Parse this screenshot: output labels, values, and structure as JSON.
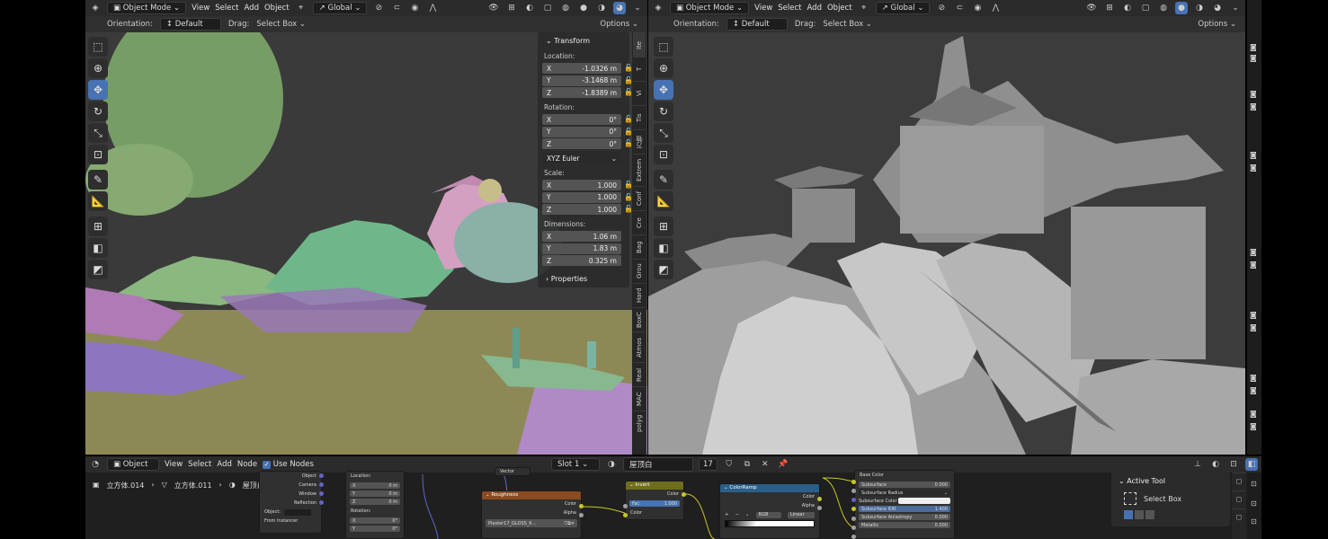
{
  "left_viewport": {
    "header": {
      "mode": "Object Mode",
      "menus": [
        "View",
        "Select",
        "Add",
        "Object"
      ],
      "transform_orientation": "Global",
      "options": "Options"
    },
    "subheader": {
      "orientation_label": "Orientation:",
      "orientation_value": "Default",
      "drag_label": "Drag:",
      "drag_value": "Select Box"
    },
    "transform_panel": {
      "title": "Transform",
      "location_label": "Location:",
      "location": [
        {
          "axis": "X",
          "value": "-1.0326 m"
        },
        {
          "axis": "Y",
          "value": "-3.1468 m"
        },
        {
          "axis": "Z",
          "value": "-1.8389 m"
        }
      ],
      "rotation_label": "Rotation:",
      "rotation": [
        {
          "axis": "X",
          "value": "0°"
        },
        {
          "axis": "Y",
          "value": "0°"
        },
        {
          "axis": "Z",
          "value": "0°"
        }
      ],
      "rotation_mode": "XYZ Euler",
      "scale_label": "Scale:",
      "scale": [
        {
          "axis": "X",
          "value": "1.000"
        },
        {
          "axis": "Y",
          "value": "1.000"
        },
        {
          "axis": "Z",
          "value": "1.000"
        }
      ],
      "dimensions_label": "Dimensions:",
      "dimensions": [
        {
          "axis": "X",
          "value": "1.06 m"
        },
        {
          "axis": "Y",
          "value": "1.83 m"
        },
        {
          "axis": "Z",
          "value": "0.325 m"
        }
      ],
      "properties_label": "Properties"
    },
    "side_tabs": [
      "Ite",
      "T",
      "Vi",
      "Tis",
      "万物",
      "Extrem",
      "Conf",
      "Cre",
      "Bag",
      "Grou",
      "Hard",
      "BoxC",
      "Atmos",
      "Real",
      "MAC",
      "polyg"
    ]
  },
  "right_viewport": {
    "header": {
      "mode": "Object Mode",
      "menus": [
        "View",
        "Select",
        "Add",
        "Object"
      ],
      "transform_orientation": "Global",
      "options": "Options"
    },
    "subheader": {
      "orientation_label": "Orientation:",
      "orientation_value": "Default",
      "drag_label": "Drag:",
      "drag_value": "Select Box"
    }
  },
  "node_editor": {
    "header": {
      "type": "Object",
      "menus": [
        "View",
        "Select",
        "Add",
        "Node"
      ],
      "use_nodes_label": "Use Nodes",
      "use_nodes_checked": true,
      "slot": "Slot 1",
      "material": "屋顶白",
      "users": "17"
    },
    "breadcrumb": [
      "立方体.014",
      "立方体.011",
      "屋顶白"
    ],
    "nodes": {
      "light_path_rows": [
        "Object",
        "Camera",
        "Window",
        "Reflection"
      ],
      "object_label": "Object:",
      "from_instancer": "From Instancer",
      "mapping": {
        "location_label": "Location:",
        "location": [
          {
            "axis": "X",
            "value": "0 m"
          },
          {
            "axis": "Y",
            "value": "0 m"
          },
          {
            "axis": "Z",
            "value": "0 m"
          }
        ],
        "rotation_label": "Rotation:",
        "rotation": [
          {
            "axis": "X",
            "value": "0°"
          },
          {
            "axis": "Y",
            "value": "0°"
          }
        ]
      },
      "vector_label": "Vector",
      "roughness": {
        "title": "Roughness",
        "out_color": "Color",
        "out_alpha": "Alpha",
        "image": "Plaster17_GLOSS_6..."
      },
      "invert": {
        "title": "Invert",
        "out_color": "Color",
        "fac_label": "Fac",
        "fac_value": "1.000",
        "in_color": "Color"
      },
      "colorramp": {
        "title": "ColorRamp",
        "out_color": "Color",
        "out_alpha": "Alpha",
        "mode": "RGB",
        "interp": "Linear"
      },
      "bsdf": {
        "base_color": "Base Color",
        "rows": [
          {
            "label": "Subsurface",
            "value": "0.000"
          },
          {
            "label": "Subsurface Radius",
            "value": ""
          },
          {
            "label": "Subsurface Color",
            "value": ""
          },
          {
            "label": "Subsurface IOR",
            "value": "1.400"
          },
          {
            "label": "Subsurface Anisotropy",
            "value": "0.000"
          },
          {
            "label": "Metallic",
            "value": "0.000"
          }
        ]
      }
    }
  },
  "active_tool": {
    "title": "Active Tool",
    "tool_name": "Select Box"
  },
  "colors": {
    "accent": "#4772b3",
    "header_bg": "#2b2b2b",
    "panel_bg": "#303030",
    "field_bg": "#545454",
    "yellow_socket": "#c7c729"
  }
}
